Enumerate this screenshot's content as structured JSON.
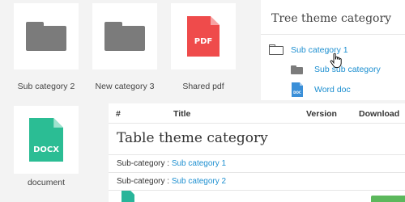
{
  "grid": {
    "tiles": [
      {
        "label": "Sub category 2",
        "icon": "folder-icon"
      },
      {
        "label": "New category 3",
        "icon": "folder-icon"
      },
      {
        "label": "Shared pdf",
        "icon": "pdf-file-icon",
        "badge": "PDF",
        "color": "#ef4b4b"
      },
      {
        "label": "document",
        "icon": "docx-file-icon",
        "badge": "DOCX",
        "color": "#2bbd94"
      }
    ]
  },
  "tree": {
    "title": "Tree theme category",
    "items": [
      {
        "label": "Sub category 1",
        "icon": "folder-outline-icon"
      },
      {
        "label": "Sub sub category",
        "icon": "folder-icon"
      },
      {
        "label": "Word doc",
        "icon": "doc-file-icon",
        "badge": "DOC",
        "color": "#3a8fd8"
      }
    ]
  },
  "table": {
    "headers": [
      "#",
      "Title",
      "Version",
      "Download"
    ],
    "title": "Table theme category",
    "rows": [
      {
        "prefix": "Sub-category :",
        "link": "Sub category 1"
      },
      {
        "prefix": "Sub-category :",
        "link": "Sub category 2"
      }
    ]
  },
  "colors": {
    "link": "#1d8fd0",
    "background": "#f3f3f3",
    "panel": "#ffffff"
  }
}
